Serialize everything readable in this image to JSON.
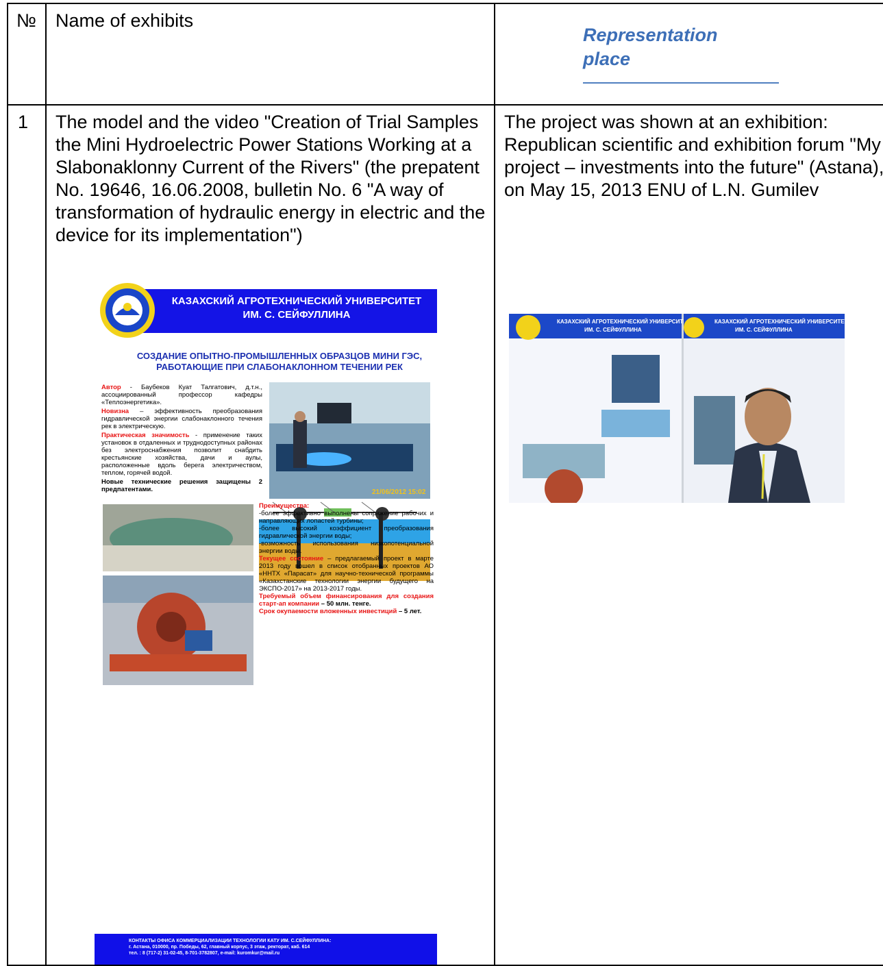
{
  "table": {
    "header": {
      "num": "№",
      "name": "Name of exhibits",
      "place_line1": "Representation",
      "place_line2": "place"
    },
    "row1": {
      "num": "1",
      "name": "The model and the video \"Creation of Trial Samples the Mini Hydroelectric Power Stations Working at a Slabonaklonny Current of the Rivers\" (the prepatent No. 19646, 16.06.2008, bulletin No. 6 \"A way of transformation of hydraulic energy in electric and the device for its implementation\")",
      "place": "The project was shown at an exhibition: Republican scientific and exhibition forum \"My project – investments into the future\" (Astana), on May 15, 2013 ENU of L.N. Gumilev"
    }
  },
  "poster": {
    "university_line1": "КАЗАХСКИЙ АГРОТЕХНИЧЕСКИЙ УНИВЕРСИТЕТ",
    "university_line2": "ИМ. С. СЕЙФУЛЛИНА",
    "title_line1": "СОЗДАНИЕ ОПЫТНО-ПРОМЫШЛЕННЫХ ОБРАЗЦОВ МИНИ ГЭС,",
    "title_line2": "РАБОТАЮЩИЕ ПРИ СЛАБОНАКЛОННОМ ТЕЧЕНИИ РЕК",
    "author_label": "Автор",
    "author_text": " - Баубеков Куат Талгатович, д.т.н., ассоциированный профессор кафедры «Теплоэнергетика».",
    "novelty_label": "Новизна",
    "novelty_text": " – эффективность преобразования гидравлической энергии слабонаклонного течения рек в электрическую.",
    "practical_label": "Практическая значимость",
    "practical_text": " - применение таких установок в отдаленных и труднодоступных районах без электроснабжения позволит снабдить крестьянские хозяйства, дачи и аулы, расположенные вдоль берега электричеством, теплом, горячей водой.",
    "patents_text": "Новые технические решения защищены 2 предпатентами.",
    "photo_timestamp": "21/06/2012 15:02",
    "advantages_label": "Преимущества:",
    "advantage_1": "-более эффективно выполнены сопряжение рабочих и направляющих лопастей турбины;",
    "advantage_2": "-более высокий коэффициент преобразования гидравлической энергии воды;",
    "advantage_3": "-возможность использования низкопотенциальной энергии воды.",
    "status_label": "Текущее состояние",
    "status_text": " – предлагаемый проект в марте 2013 году вошел в список отобранных проектов АО «ННТХ «Парасат» для научно-технической программы «Казахстанские технологии энергии будущего на ЭКСПО-2017» на 2013-2017 годы.",
    "funding_label": "Требуемый объем финансирования для создания старт-ап компании",
    "funding_value": " – 50 млн. тенге.",
    "payback_label": "Срок окупаемости вложенных инвестиций",
    "payback_value": " – 5 лет.",
    "footer_line1": "КОНТАКТЫ ОФИСА КОММЕРЦИАЛИЗАЦИИ ТЕХНОЛОГИИ КАТУ ИМ. С.СЕЙФУЛЛИНА:",
    "footer_line2": "г. Астана, 010000, пр. Победы, 62, главный корпус, 3 этаж, ректорат, каб. 614",
    "footer_line3": "тел. : 8 (717-2) 31-02-45, 8-701-3782807, e-mail: kuromkur@mail.ru",
    "colors": {
      "banner": "#1414e6",
      "title": "#1b2fb0",
      "accent": "#e81515"
    }
  },
  "exhibition_photo": {
    "board1_uni": "КАЗАХСКИЙ АГРОТЕХНИЧЕСКИЙ УНИВЕРСИТЕТ",
    "board1_uni2": "ИМ. С. СЕЙФУЛЛИНА",
    "board2_uni": "КАЗАХСКИЙ АГРОТЕХНИЧЕСКИЙ УНИВЕРСИТЕТ",
    "board2_uni2": "ИМ. С. СЕЙФУЛЛИНА"
  }
}
